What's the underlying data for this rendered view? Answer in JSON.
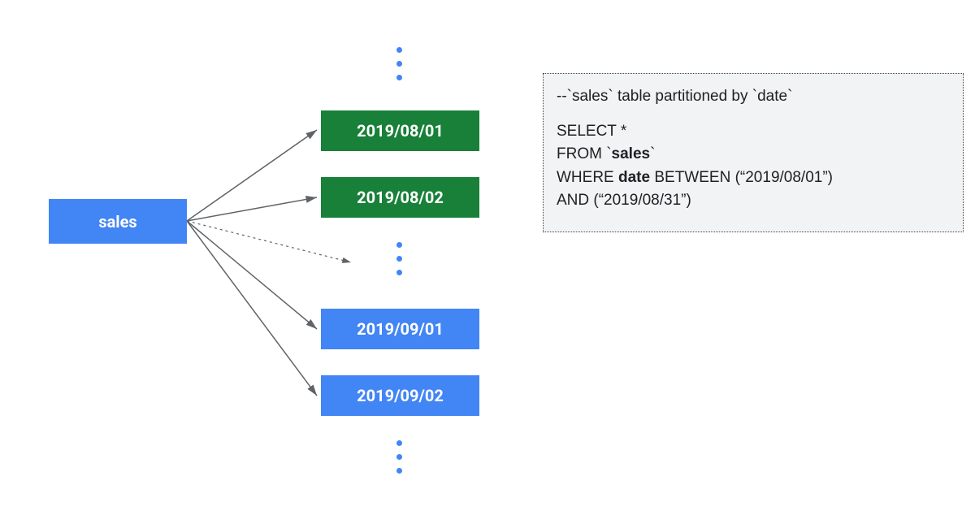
{
  "source": {
    "label": "sales"
  },
  "partitions": {
    "green1": "2019/08/01",
    "green2": "2019/08/02",
    "blue1": "2019/09/01",
    "blue2": "2019/09/02"
  },
  "query": {
    "comment": "--`sales` table partitioned by `date`",
    "line1": "SELECT *",
    "line2_prefix": "FROM `",
    "line2_bold": "sales",
    "line2_suffix": "`",
    "line3_prefix": "WHERE ",
    "line3_bold": "date",
    "line3_suffix": " BETWEEN (“2019/08/01”)",
    "line4": "AND (“2019/08/31”)"
  },
  "colors": {
    "blue": "#4285F4",
    "green": "#188038",
    "panel": "#F1F3F4"
  }
}
